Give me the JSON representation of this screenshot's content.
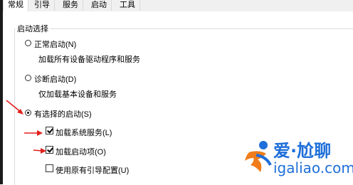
{
  "tabs": [
    {
      "label": "常规",
      "active": true
    },
    {
      "label": "引导",
      "active": false
    },
    {
      "label": "服务",
      "active": false
    },
    {
      "label": "启动",
      "active": false
    },
    {
      "label": "工具",
      "active": false
    }
  ],
  "startup_selection": {
    "group_title": "启动选择",
    "normal": {
      "label": "正常启动(N)",
      "description": "加载所有设备驱动程序和服务",
      "checked": false
    },
    "diagnostic": {
      "label": "诊断启动(D)",
      "description": "仅加载基本设备和服务",
      "checked": false
    },
    "selective": {
      "label": "有选择的启动(S)",
      "checked": true
    },
    "load_system_services": {
      "label": "加载系统服务(L)",
      "checked": true
    },
    "load_startup_items": {
      "label": "加载启动项(O)",
      "checked": true
    },
    "use_original_boot": {
      "label": "使用原有引导配置(U)",
      "checked": false
    }
  },
  "watermark": {
    "name": "爱·尬聊",
    "url": "igaliao.com"
  },
  "colors": {
    "arrow": "#e0201c",
    "watermark_blue": "#1e6fd9",
    "watermark_orange": "#f07d1a"
  }
}
